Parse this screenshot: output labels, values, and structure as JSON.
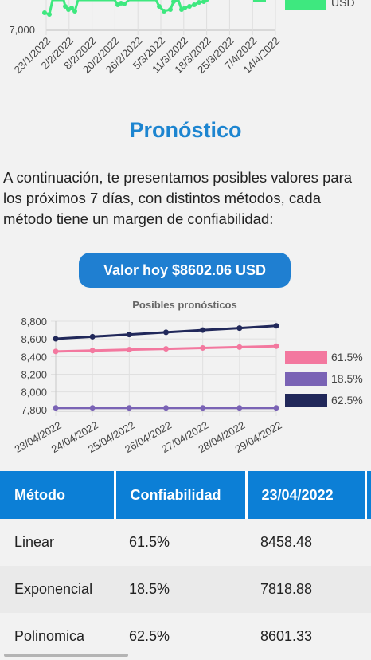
{
  "top_chart": {
    "y_tick": "7,000",
    "x_labels": [
      "23/1/2022",
      "2/2/2022",
      "8/2/2022",
      "20/2/2022",
      "26/2/2022",
      "5/3/2022",
      "11/3/2022",
      "18/3/2022",
      "25/3/2022",
      "7/4/2022",
      "14/4/2022"
    ],
    "legend_label": "USD",
    "color": "#3ee87f"
  },
  "section_title": "Pronóstico",
  "intro_text": "A continuación, te presentamos posibles valores para los próximos 7 días, con distintos métodos, cada método tiene un margen de confiabilidad:",
  "value_button": "Valor hoy $8602.06 USD",
  "chart_data": {
    "type": "line",
    "title": "Posibles pronósticos",
    "xlabel": "",
    "ylabel": "",
    "categories": [
      "23/04/2022",
      "24/04/2022",
      "25/04/2022",
      "26/04/2022",
      "27/04/2022",
      "28/04/2022",
      "29/04/2022"
    ],
    "y_ticks": [
      "7,800",
      "8,000",
      "8,200",
      "8,400",
      "8,600",
      "8,800"
    ],
    "ylim": [
      7780,
      8800
    ],
    "legend_position": "right",
    "grid": true,
    "series": [
      {
        "name": "61.5%",
        "color": "#f3789f",
        "values": [
          8458.48,
          8468,
          8478,
          8488,
          8498,
          8508,
          8518
        ]
      },
      {
        "name": "18.5%",
        "color": "#7a63b5",
        "values": [
          7818.88,
          7818.88,
          7818.88,
          7818.88,
          7818.88,
          7818.88,
          7818.88
        ]
      },
      {
        "name": "62.5%",
        "color": "#21285a",
        "values": [
          8601.33,
          8625,
          8650,
          8675,
          8700,
          8722,
          8748
        ]
      }
    ]
  },
  "table": {
    "headers": [
      "Método",
      "Confiabilidad",
      "23/04/2022"
    ],
    "rows": [
      [
        "Linear",
        "61.5%",
        "8458.48"
      ],
      [
        "Exponencial",
        "18.5%",
        "7818.88"
      ],
      [
        "Polinomica",
        "62.5%",
        "8601.33"
      ]
    ]
  }
}
